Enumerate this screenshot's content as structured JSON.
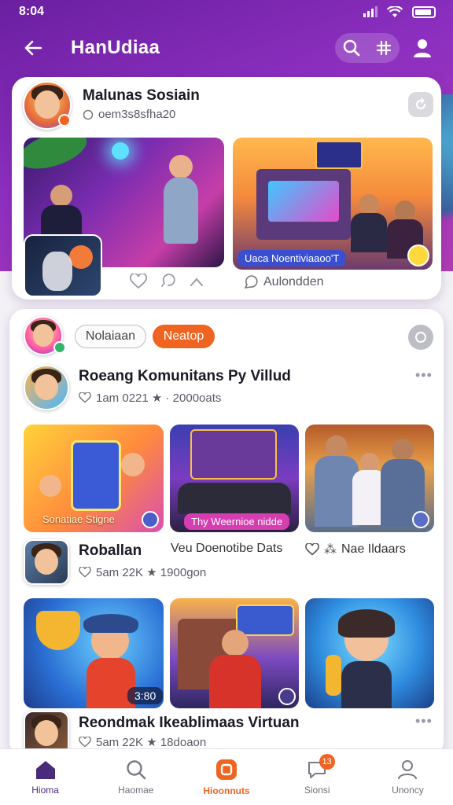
{
  "status_bar": {
    "time": "8:04"
  },
  "header": {
    "title": "HanUdiaa"
  },
  "feed": {
    "post1": {
      "author": "Malunas Sosiain",
      "handle": "oem3s8sfha20",
      "tile2_caption": "Uaca Noentiviaaoo'T",
      "comment_label": "Aulondden"
    },
    "post2": {
      "filter_pills": [
        "Nolaiaan",
        "Neatop"
      ]
    },
    "group1": {
      "title": "Roeang Komunitans Py Villud",
      "meta": "1am 0221 ★ · 2000oats",
      "tile1_caption": "Sonatiae Stigne",
      "tile2_caption": "Thy Weernioe nidde"
    },
    "group2": {
      "title": "Roballan",
      "meta": "5am 22K ★ 1900gon",
      "extra_text": "Veu Doenotibe Dats",
      "extra_meta": "Nae Ildaars",
      "time_badge": "3:80"
    },
    "group3": {
      "title": "Reondmak Ikeablimaas Virtuan",
      "meta": "5am 22K ★ 18doaon"
    }
  },
  "bottom_nav": [
    {
      "label": "Hioma",
      "icon": "home-icon"
    },
    {
      "label": "Haomae",
      "icon": "search-icon"
    },
    {
      "label": "Hioonnuts",
      "icon": "creator-icon"
    },
    {
      "label": "Sionsi",
      "icon": "chat-icon"
    },
    {
      "label": "Unoncy",
      "icon": "profile-icon"
    }
  ],
  "badges": {
    "notification_count": "13"
  },
  "colors": {
    "primary": "#7b2bb0",
    "accent": "#f06422",
    "nav_active": "#4a2a7a"
  }
}
